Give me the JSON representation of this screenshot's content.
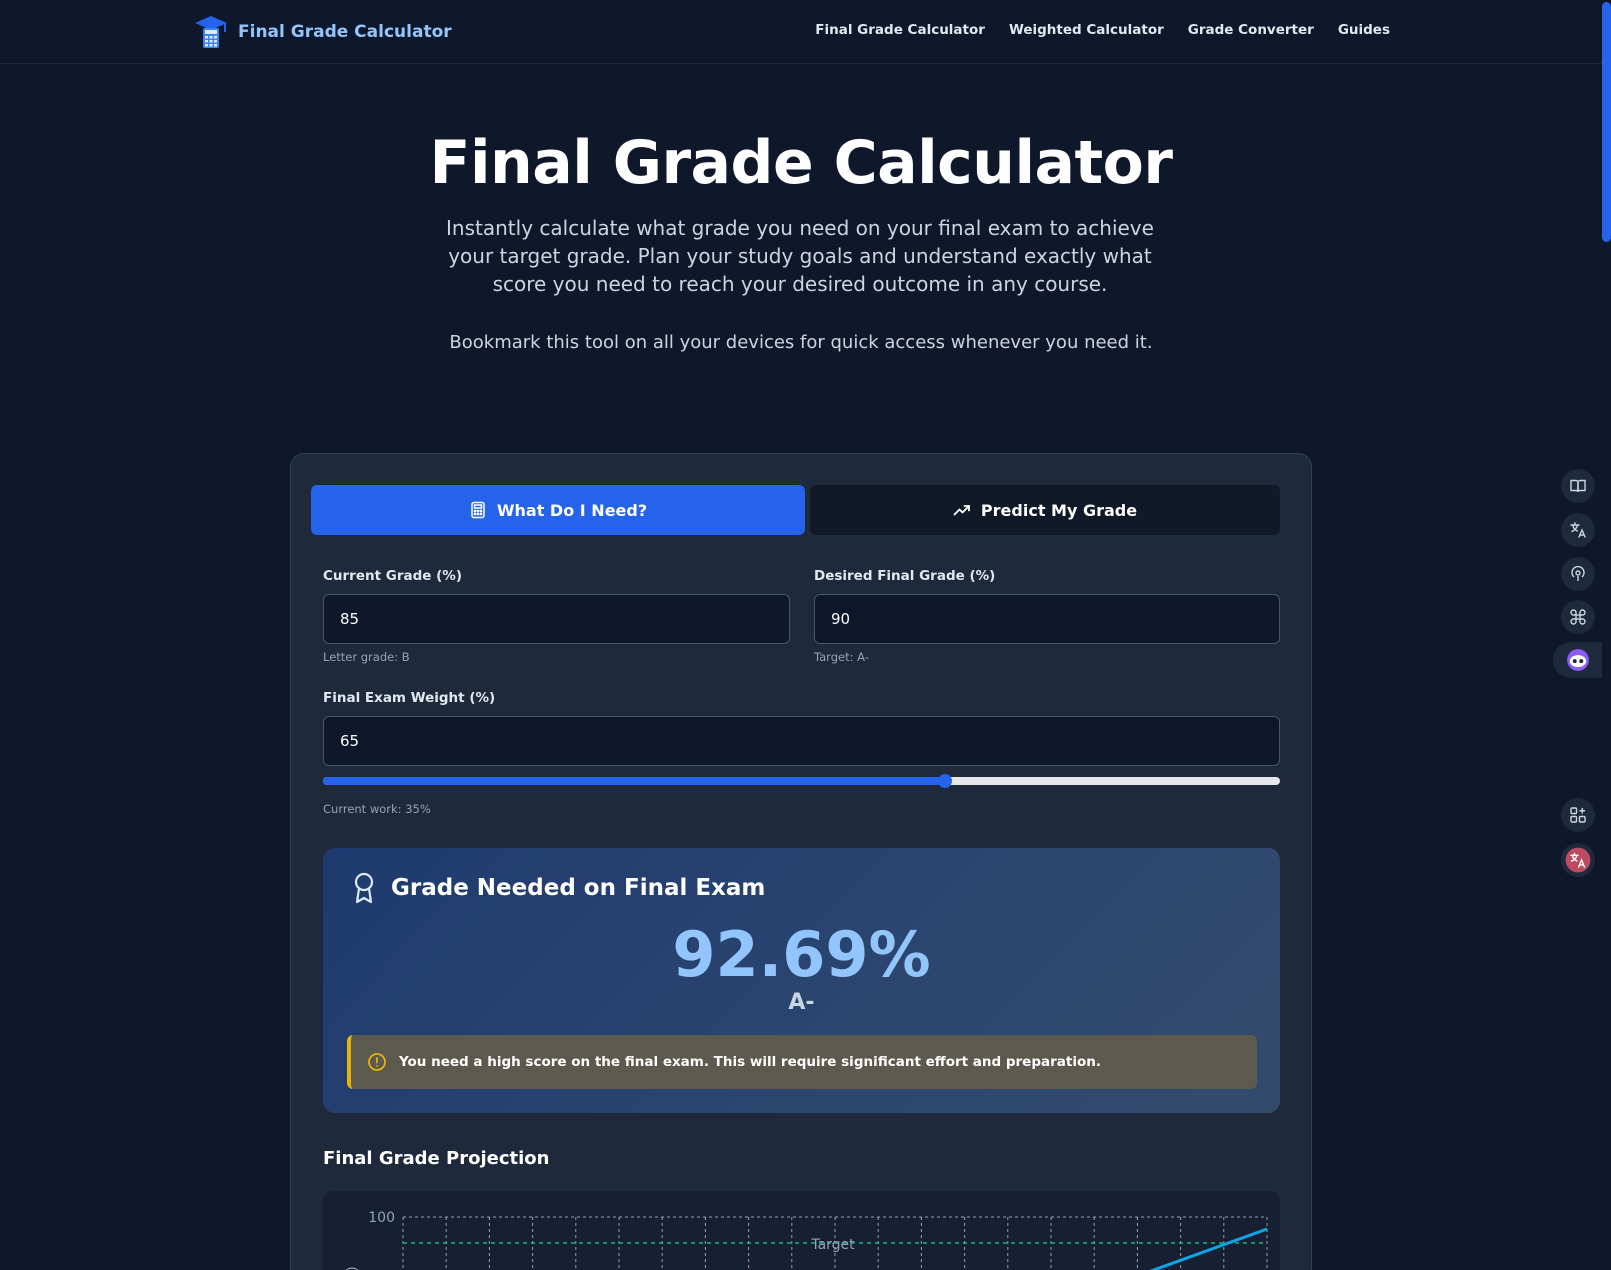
{
  "brand": {
    "name": "Final Grade Calculator"
  },
  "nav": {
    "links": [
      {
        "label": "Final Grade Calculator"
      },
      {
        "label": "Weighted Calculator"
      },
      {
        "label": "Grade Converter"
      },
      {
        "label": "Guides"
      }
    ]
  },
  "hero": {
    "title": "Final Grade Calculator",
    "subtitle": "Instantly calculate what grade you need on your final exam to achieve your target grade. Plan your study goals and understand exactly what score you need to reach your desired outcome in any course.",
    "note": "Bookmark this tool on all your devices for quick access whenever you need it."
  },
  "tabs": {
    "need": "What Do I Need?",
    "predict": "Predict My Grade"
  },
  "form": {
    "current": {
      "label": "Current Grade (%)",
      "value": "85",
      "hint": "Letter grade: B"
    },
    "desired": {
      "label": "Desired Final Grade (%)",
      "value": "90",
      "hint": "Target: A-"
    },
    "weight": {
      "label": "Final Exam Weight (%)",
      "value": "65",
      "hint": "Current work: 35%",
      "slider_percent": 65
    }
  },
  "result": {
    "title": "Grade Needed on Final Exam",
    "value": "92.69%",
    "letter": "A-",
    "alert": "You need a high score on the final exam. This will require significant effort and preparation."
  },
  "projection": {
    "title": "Final Grade Projection"
  },
  "chart_data": {
    "type": "line",
    "ylabel": "e (%)",
    "y_tick_labels": [
      "100"
    ],
    "target_label": "Target",
    "target_value": 90,
    "series": [
      {
        "values": []
      }
    ]
  },
  "colors": {
    "background": "#0f172a",
    "card": "#1e293b",
    "accent": "#2563eb",
    "result_value": "#93c5fd",
    "alert_border": "#eab308",
    "target_line": "#10b981"
  },
  "side_icons": [
    "book-icon",
    "translate-icon",
    "podcast-icon",
    "command-icon",
    "robot-icon",
    "apps-add-icon",
    "translate-red-icon"
  ]
}
